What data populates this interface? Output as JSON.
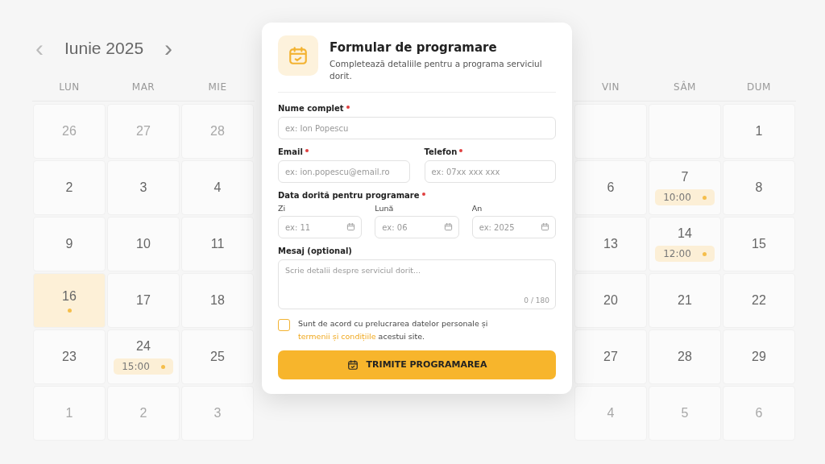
{
  "calendar": {
    "month": "Iunie 2025",
    "prev": "‹",
    "next": "›",
    "weekdays": [
      "LUN",
      "MAR",
      "MIE",
      "VIN",
      "SÂM",
      "DUM"
    ],
    "weeks": [
      {
        "days": [
          {
            "day": "26",
            "muted": true,
            "selected": false
          },
          {
            "day": "27",
            "muted": true,
            "selected": false
          },
          {
            "day": "28",
            "muted": true,
            "selected": false
          },
          {
            "selected": false
          },
          {
            "selected": false
          },
          {
            "day": "1",
            "muted": false,
            "selected": false
          }
        ]
      },
      {
        "days": [
          {
            "day": "2",
            "muted": false,
            "selected": false
          },
          {
            "day": "3",
            "muted": false,
            "selected": false
          },
          {
            "day": "4",
            "muted": false,
            "selected": false
          },
          {
            "day": "6",
            "muted": false,
            "selected": false
          },
          {
            "day": "7",
            "muted": false,
            "selected": false,
            "event": "10:00"
          },
          {
            "day": "8",
            "muted": false,
            "selected": false
          }
        ]
      },
      {
        "days": [
          {
            "day": "9",
            "muted": false,
            "selected": false
          },
          {
            "day": "10",
            "muted": false,
            "selected": false
          },
          {
            "day": "11",
            "muted": false,
            "selected": false
          },
          {
            "day": "13",
            "muted": false,
            "selected": false
          },
          {
            "day": "14",
            "muted": false,
            "selected": false,
            "event": "12:00"
          },
          {
            "day": "15",
            "muted": false,
            "selected": false
          }
        ]
      },
      {
        "days": [
          {
            "day": "16",
            "muted": false,
            "selected": true,
            "marker": true
          },
          {
            "day": "17",
            "muted": false,
            "selected": false
          },
          {
            "day": "18",
            "muted": false,
            "selected": false
          },
          {
            "day": "20",
            "muted": false,
            "selected": false
          },
          {
            "day": "21",
            "muted": false,
            "selected": false
          },
          {
            "day": "22",
            "muted": false,
            "selected": false
          }
        ]
      },
      {
        "days": [
          {
            "day": "23",
            "muted": false,
            "selected": false
          },
          {
            "day": "24",
            "muted": false,
            "selected": false,
            "event": "15:00"
          },
          {
            "day": "25",
            "muted": false,
            "selected": false
          },
          {
            "day": "27",
            "muted": false,
            "selected": false
          },
          {
            "day": "28",
            "muted": false,
            "selected": false
          },
          {
            "day": "29",
            "muted": false,
            "selected": false
          }
        ]
      },
      {
        "days": [
          {
            "day": "1",
            "muted": true,
            "selected": false
          },
          {
            "day": "2",
            "muted": true,
            "selected": false
          },
          {
            "day": "3",
            "muted": true,
            "selected": false
          },
          {
            "day": "4",
            "muted": true,
            "selected": false
          },
          {
            "day": "5",
            "muted": true,
            "selected": false
          },
          {
            "day": "6",
            "muted": true,
            "selected": false
          }
        ]
      }
    ]
  },
  "form": {
    "title": "Formular de programare",
    "subtitle": "Completează detaliile pentru a programa serviciul dorit.",
    "name": {
      "label": "Nume complet",
      "required": true,
      "placeholder": "ex: Ion Popescu"
    },
    "email": {
      "label": "Email",
      "required": true,
      "placeholder": "ex: ion.popescu@email.ro"
    },
    "phone": {
      "label": "Telefon",
      "required": true,
      "placeholder": "ex: 07xx xxx xxx"
    },
    "date": {
      "label": "Data dorită pentru programare",
      "required": true,
      "parts": [
        {
          "label": "Zi",
          "placeholder": "ex: 11"
        },
        {
          "label": "Lună",
          "placeholder": "ex: 06"
        },
        {
          "label": "An",
          "placeholder": "ex: 2025"
        }
      ]
    },
    "message": {
      "label": "Mesaj (optional)",
      "placeholder": "Scrie detalii despre serviciul dorit...",
      "counter": "0 / 180"
    },
    "consent": {
      "checked": false,
      "text_before": "Sunt de acord cu prelucrarea datelor personale și",
      "link": "termenii și condițiile",
      "text_after": "acestui site."
    },
    "submit": "TRIMITE PROGRAMAREA"
  }
}
